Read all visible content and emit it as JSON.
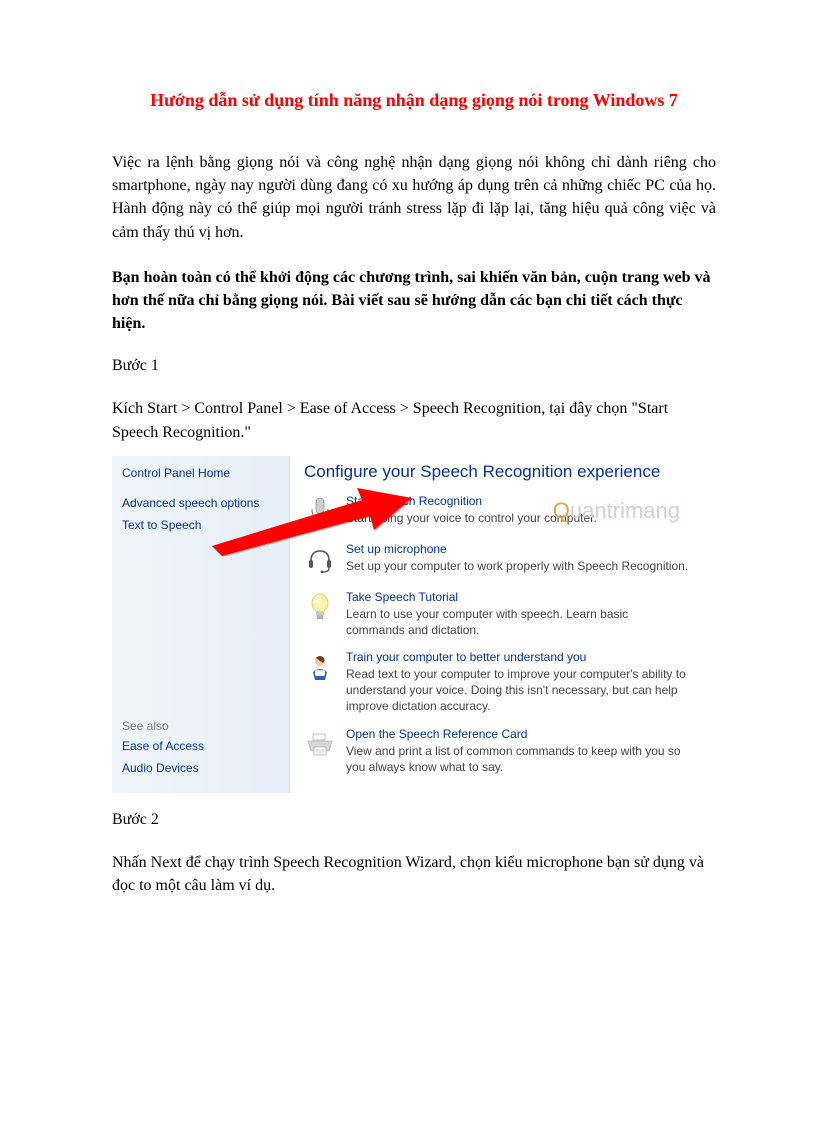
{
  "title": "Hướng dẫn sử dụng tính năng nhận dạng giọng nói trong Windows 7",
  "intro": "Việc ra lệnh bằng giọng nói và công nghệ nhận dạng giọng nói không chỉ dành riêng cho smartphone, ngày nay người dùng đang có xu hướng áp dụng trên cả những chiếc PC của họ. Hành động này có thể giúp mọi người tránh stress lặp đi lặp lại, tăng hiệu quả công việc và cảm thấy thú vị hơn.",
  "bold_intro": "Bạn hoàn toàn có thể khởi động các chương trình, sai khiến văn bản, cuộn trang web và hơn thế nữa chỉ bằng giọng nói. Bài viết sau sẽ hướng dẫn các bạn chi tiết cách thực hiện.",
  "step1_label": "Bước 1",
  "step1_text": "Kích Start > Control Panel > Ease of Access > Speech Recognition, tại đây chọn \"Start Speech Recognition.\"",
  "step2_label": "Bước 2",
  "step2_text": "Nhấn Next để chạy trình Speech Recognition Wizard, chọn kiểu microphone bạn sử dụng và đọc to một câu làm ví dụ.",
  "control_panel": {
    "sidebar": {
      "home": "Control Panel Home",
      "advanced": "Advanced speech options",
      "tts": "Text to Speech",
      "see_also_label": "See also",
      "see_also": [
        "Ease of Access",
        "Audio Devices"
      ]
    },
    "heading": "Configure your Speech Recognition experience",
    "rows": [
      {
        "link": "Start Speech Recognition",
        "desc": "Start using your voice to control your computer."
      },
      {
        "link": "Set up microphone",
        "desc": "Set up your computer to work properly with Speech Recognition."
      },
      {
        "link": "Take Speech Tutorial",
        "desc": "Learn to use your computer with speech.  Learn basic commands and dictation."
      },
      {
        "link": "Train your computer to better understand you",
        "desc": "Read text to your computer to improve your computer's ability to understand your voice.  Doing this isn't necessary, but can help improve dictation accuracy."
      },
      {
        "link": "Open the Speech Reference Card",
        "desc": "View and print a list of common commands to keep with you so you always know what to say."
      }
    ]
  },
  "watermark": "uantrimang"
}
